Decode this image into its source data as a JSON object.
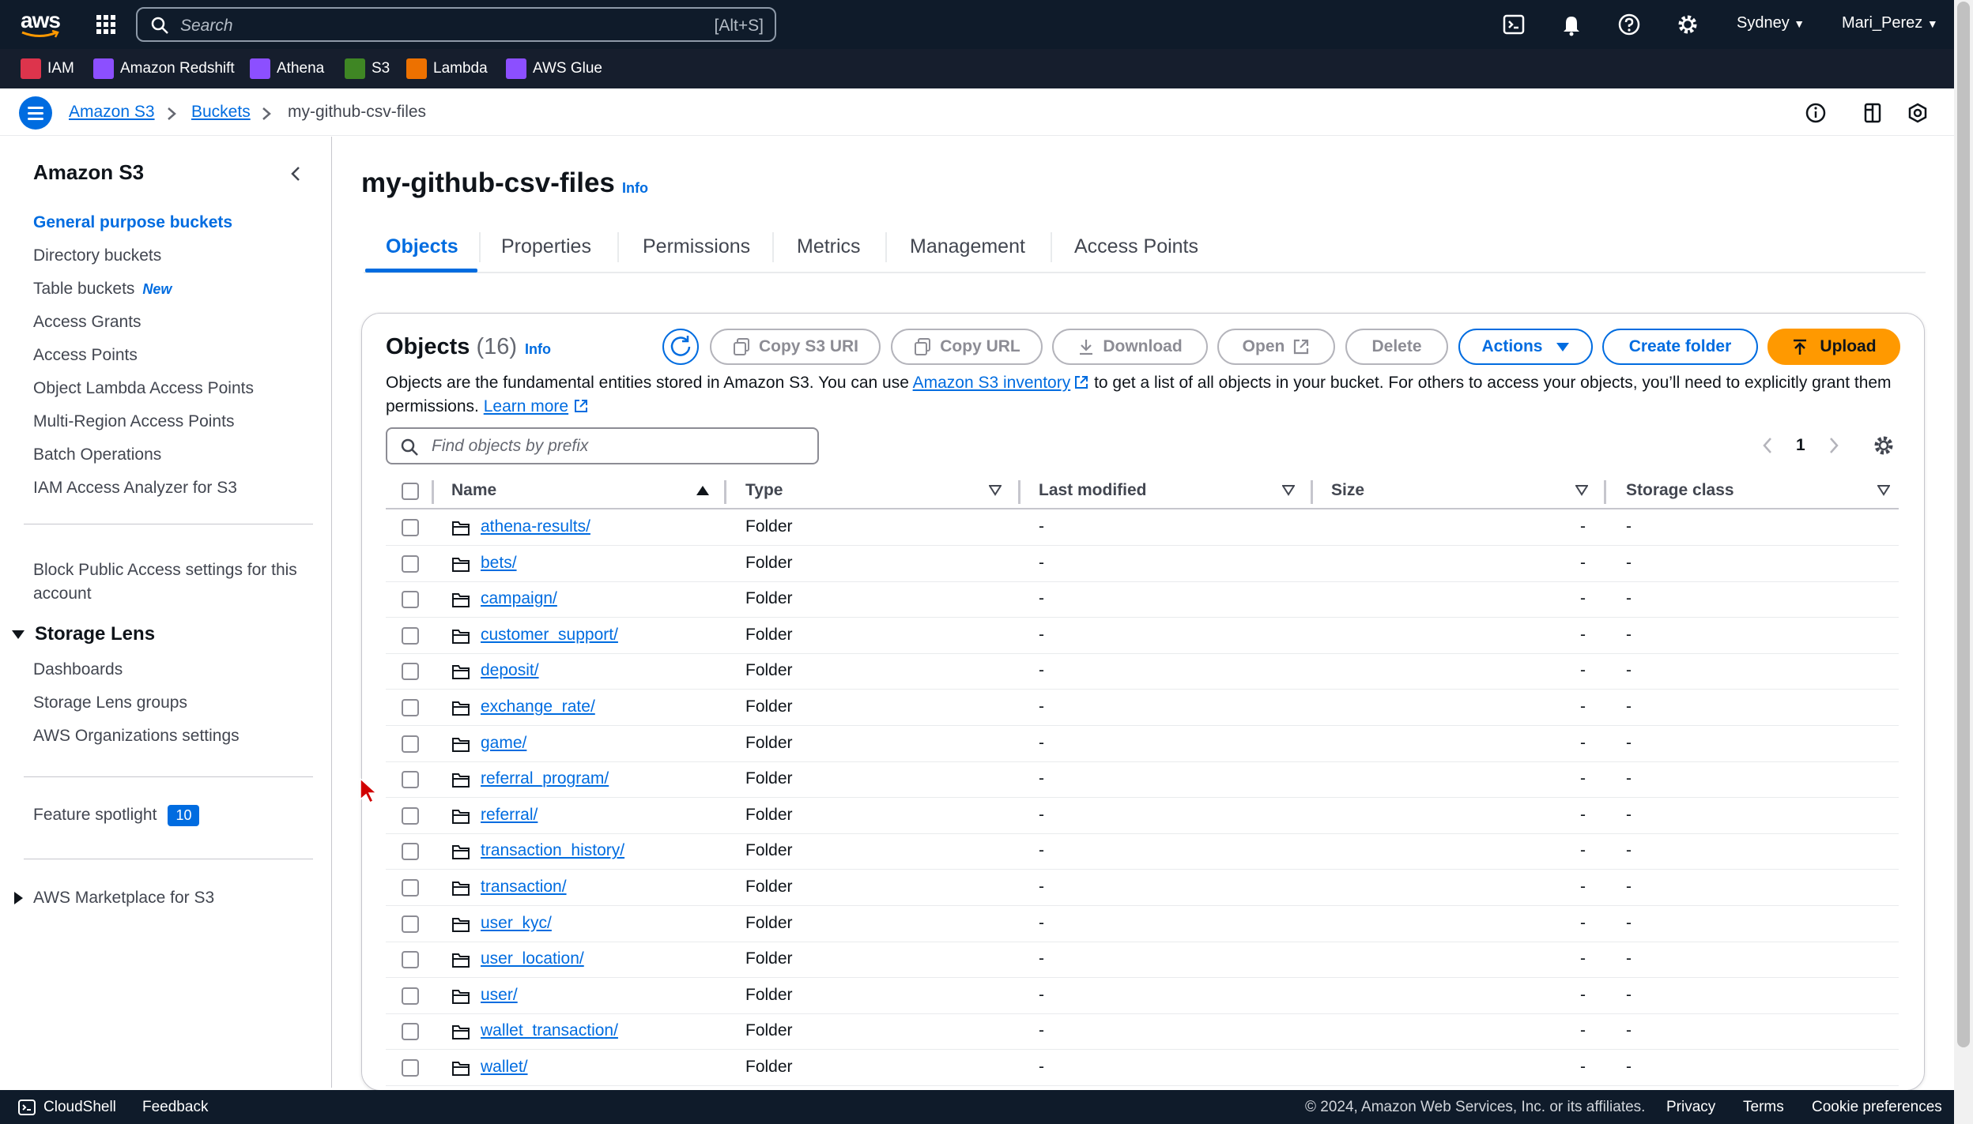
{
  "topnav": {
    "logo": "aws",
    "search_placeholder": "Search",
    "search_shortcut": "[Alt+S]",
    "region": "Sydney",
    "user": "Mari_Perez",
    "icons": [
      "cloudshell-icon",
      "bell-icon",
      "help-icon",
      "gear-icon"
    ]
  },
  "favorites": [
    {
      "label": "IAM",
      "color": "#dd344c"
    },
    {
      "label": "Amazon Redshift",
      "color": "#8c4fff"
    },
    {
      "label": "Athena",
      "color": "#8c4fff"
    },
    {
      "label": "S3",
      "color": "#3f8624"
    },
    {
      "label": "Lambda",
      "color": "#ed7100"
    },
    {
      "label": "AWS Glue",
      "color": "#8c4fff"
    }
  ],
  "breadcrumb": {
    "items": [
      "Amazon S3",
      "Buckets",
      "my-github-csv-files"
    ]
  },
  "sidebar": {
    "title": "Amazon S3",
    "items": [
      {
        "label": "General purpose buckets"
      },
      {
        "label": "Directory buckets"
      },
      {
        "label": "Table buckets"
      },
      {
        "label": "Access Grants"
      },
      {
        "label": "Access Points"
      },
      {
        "label": "Object Lambda Access Points"
      },
      {
        "label": "Multi-Region Access Points"
      },
      {
        "label": "Batch Operations"
      },
      {
        "label": "IAM Access Analyzer for S3"
      }
    ],
    "new_badge": "New",
    "block_public": "Block Public Access settings for this account",
    "storage_lens": "Storage Lens",
    "lens_items": [
      "Dashboards",
      "Storage Lens groups",
      "AWS Organizations settings"
    ],
    "feature_spotlight": "Feature spotlight",
    "feature_count": "10",
    "marketplace": "AWS Marketplace for S3"
  },
  "page": {
    "title": "my-github-csv-files",
    "info": "Info",
    "tabs": [
      "Objects",
      "Properties",
      "Permissions",
      "Metrics",
      "Management",
      "Access Points"
    ]
  },
  "objects": {
    "header": "Objects",
    "count": "(16)",
    "info": "Info",
    "buttons": {
      "copy_uri": "Copy S3 URI",
      "copy_url": "Copy URL",
      "download": "Download",
      "open": "Open",
      "delete": "Delete",
      "actions": "Actions",
      "create_folder": "Create folder",
      "upload": "Upload"
    },
    "desc_1": "Objects are the fundamental entities stored in Amazon S3. You can use",
    "desc_link": "Amazon S3 inventory",
    "desc_2": "to get a list of all objects in your bucket. For others to access your objects, you’ll need to explicitly grant them permissions.",
    "learn_more": "Learn more",
    "find_placeholder": "Find objects by prefix",
    "page_number": "1",
    "columns": [
      "Name",
      "Type",
      "Last modified",
      "Size",
      "Storage class"
    ],
    "rows": [
      {
        "name": "athena-results/",
        "type": "Folder",
        "last_modified": "-",
        "size": "-",
        "storage_class": "-"
      },
      {
        "name": "bets/",
        "type": "Folder",
        "last_modified": "-",
        "size": "-",
        "storage_class": "-"
      },
      {
        "name": "campaign/",
        "type": "Folder",
        "last_modified": "-",
        "size": "-",
        "storage_class": "-"
      },
      {
        "name": "customer_support/",
        "type": "Folder",
        "last_modified": "-",
        "size": "-",
        "storage_class": "-"
      },
      {
        "name": "deposit/",
        "type": "Folder",
        "last_modified": "-",
        "size": "-",
        "storage_class": "-"
      },
      {
        "name": "exchange_rate/",
        "type": "Folder",
        "last_modified": "-",
        "size": "-",
        "storage_class": "-"
      },
      {
        "name": "game/",
        "type": "Folder",
        "last_modified": "-",
        "size": "-",
        "storage_class": "-"
      },
      {
        "name": "referral_program/",
        "type": "Folder",
        "last_modified": "-",
        "size": "-",
        "storage_class": "-"
      },
      {
        "name": "referral/",
        "type": "Folder",
        "last_modified": "-",
        "size": "-",
        "storage_class": "-"
      },
      {
        "name": "transaction_history/",
        "type": "Folder",
        "last_modified": "-",
        "size": "-",
        "storage_class": "-"
      },
      {
        "name": "transaction/",
        "type": "Folder",
        "last_modified": "-",
        "size": "-",
        "storage_class": "-"
      },
      {
        "name": "user_kyc/",
        "type": "Folder",
        "last_modified": "-",
        "size": "-",
        "storage_class": "-"
      },
      {
        "name": "user_location/",
        "type": "Folder",
        "last_modified": "-",
        "size": "-",
        "storage_class": "-"
      },
      {
        "name": "user/",
        "type": "Folder",
        "last_modified": "-",
        "size": "-",
        "storage_class": "-"
      },
      {
        "name": "wallet_transaction/",
        "type": "Folder",
        "last_modified": "-",
        "size": "-",
        "storage_class": "-"
      },
      {
        "name": "wallet/",
        "type": "Folder",
        "last_modified": "-",
        "size": "-",
        "storage_class": "-"
      }
    ]
  },
  "footer": {
    "cloudshell": "CloudShell",
    "feedback": "Feedback",
    "copyright": "© 2024, Amazon Web Services, Inc. or its affiliates.",
    "privacy": "Privacy",
    "terms": "Terms",
    "cookies": "Cookie preferences"
  },
  "colors": {
    "accent": "#006ce0",
    "upload": "#ff9900",
    "nav_bg": "#0f1b2a"
  }
}
